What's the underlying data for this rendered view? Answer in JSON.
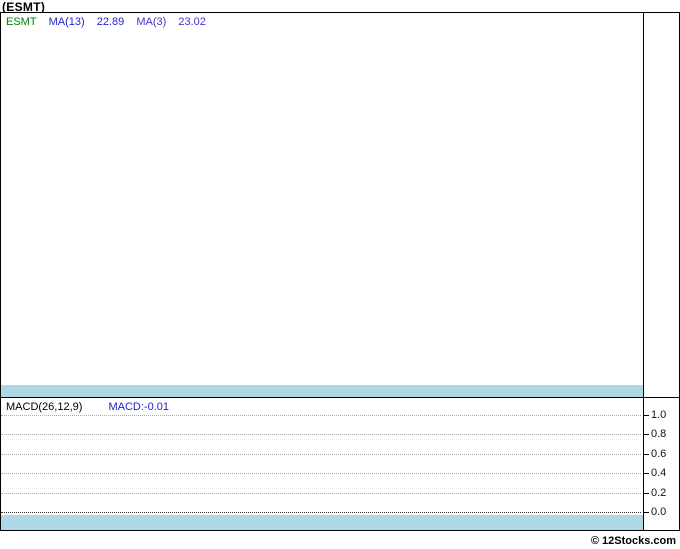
{
  "page": {
    "title": "(ESMT)",
    "copyright": "© 12Stocks.com"
  },
  "price_panel": {
    "legend": {
      "symbol": "ESMT",
      "ma1_label": "MA(13)",
      "ma1_value": "22.89",
      "ma2_label": "MA(3)",
      "ma2_value": "23.02"
    }
  },
  "macd_panel": {
    "legend_label": "MACD(26,12,9)",
    "legend_value": "MACD:-0.01",
    "axis_ticks": [
      "1.0",
      "0.8",
      "0.6",
      "0.4",
      "0.2",
      "0.0"
    ]
  },
  "colors": {
    "band_blue": "#add8e6",
    "symbol_green": "#008000",
    "ma_blue": "#2222cc",
    "ma_violet": "#4433cc",
    "border_black": "#000000",
    "gridline_gray": "#aaaaaa"
  },
  "chart_data": [
    {
      "type": "line",
      "title": "(ESMT)",
      "series": [
        {
          "name": "ESMT",
          "values": []
        },
        {
          "name": "MA(13)",
          "last_value": 22.89,
          "values": []
        },
        {
          "name": "MA(3)",
          "last_value": 23.02,
          "values": []
        }
      ],
      "legend_position": "top-left",
      "note": "price panel renders empty - no candles or lines visible"
    },
    {
      "type": "line",
      "title": "MACD(26,12,9)",
      "series": [
        {
          "name": "MACD",
          "last_value": -0.01,
          "values": []
        }
      ],
      "ylim": [
        0.0,
        1.0
      ],
      "yticks": [
        1.0,
        0.8,
        0.6,
        0.4,
        0.2,
        0.0
      ],
      "grid": true,
      "legend_position": "top-left"
    }
  ]
}
